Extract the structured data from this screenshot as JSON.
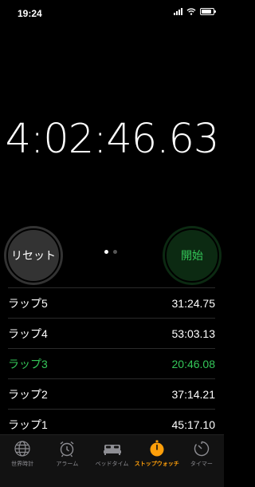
{
  "status_bar": {
    "time": "19:24",
    "battery_level": 0.85
  },
  "stopwatch": {
    "time": "4:02:46.63"
  },
  "buttons": {
    "reset_label": "リセット",
    "start_label": "開始"
  },
  "page_indicator": {
    "count": 2,
    "current": 1
  },
  "laps": [
    {
      "label": "ラップ5",
      "time": "31:24.75"
    },
    {
      "label": "ラップ4",
      "time": "53:03.13"
    },
    {
      "label": "ラップ3",
      "time": "20:46.08"
    },
    {
      "label": "ラップ2",
      "time": "37:14.21"
    },
    {
      "label": "ラップ1",
      "time": "45:17.10"
    }
  ],
  "tabs": [
    {
      "label": "世界時計",
      "icon": "globe-icon"
    },
    {
      "label": "アラーム",
      "icon": "alarm-clock-icon"
    },
    {
      "label": "ベッドタイム",
      "icon": "bed-icon"
    },
    {
      "label": "ストップウォッチ",
      "icon": "stopwatch-icon",
      "active": true
    },
    {
      "label": "タイマー",
      "icon": "timer-icon"
    }
  ],
  "colors": {
    "accent": "#ff9f0a",
    "start_green": "#33c658",
    "lap_highlight": "#34c759"
  }
}
